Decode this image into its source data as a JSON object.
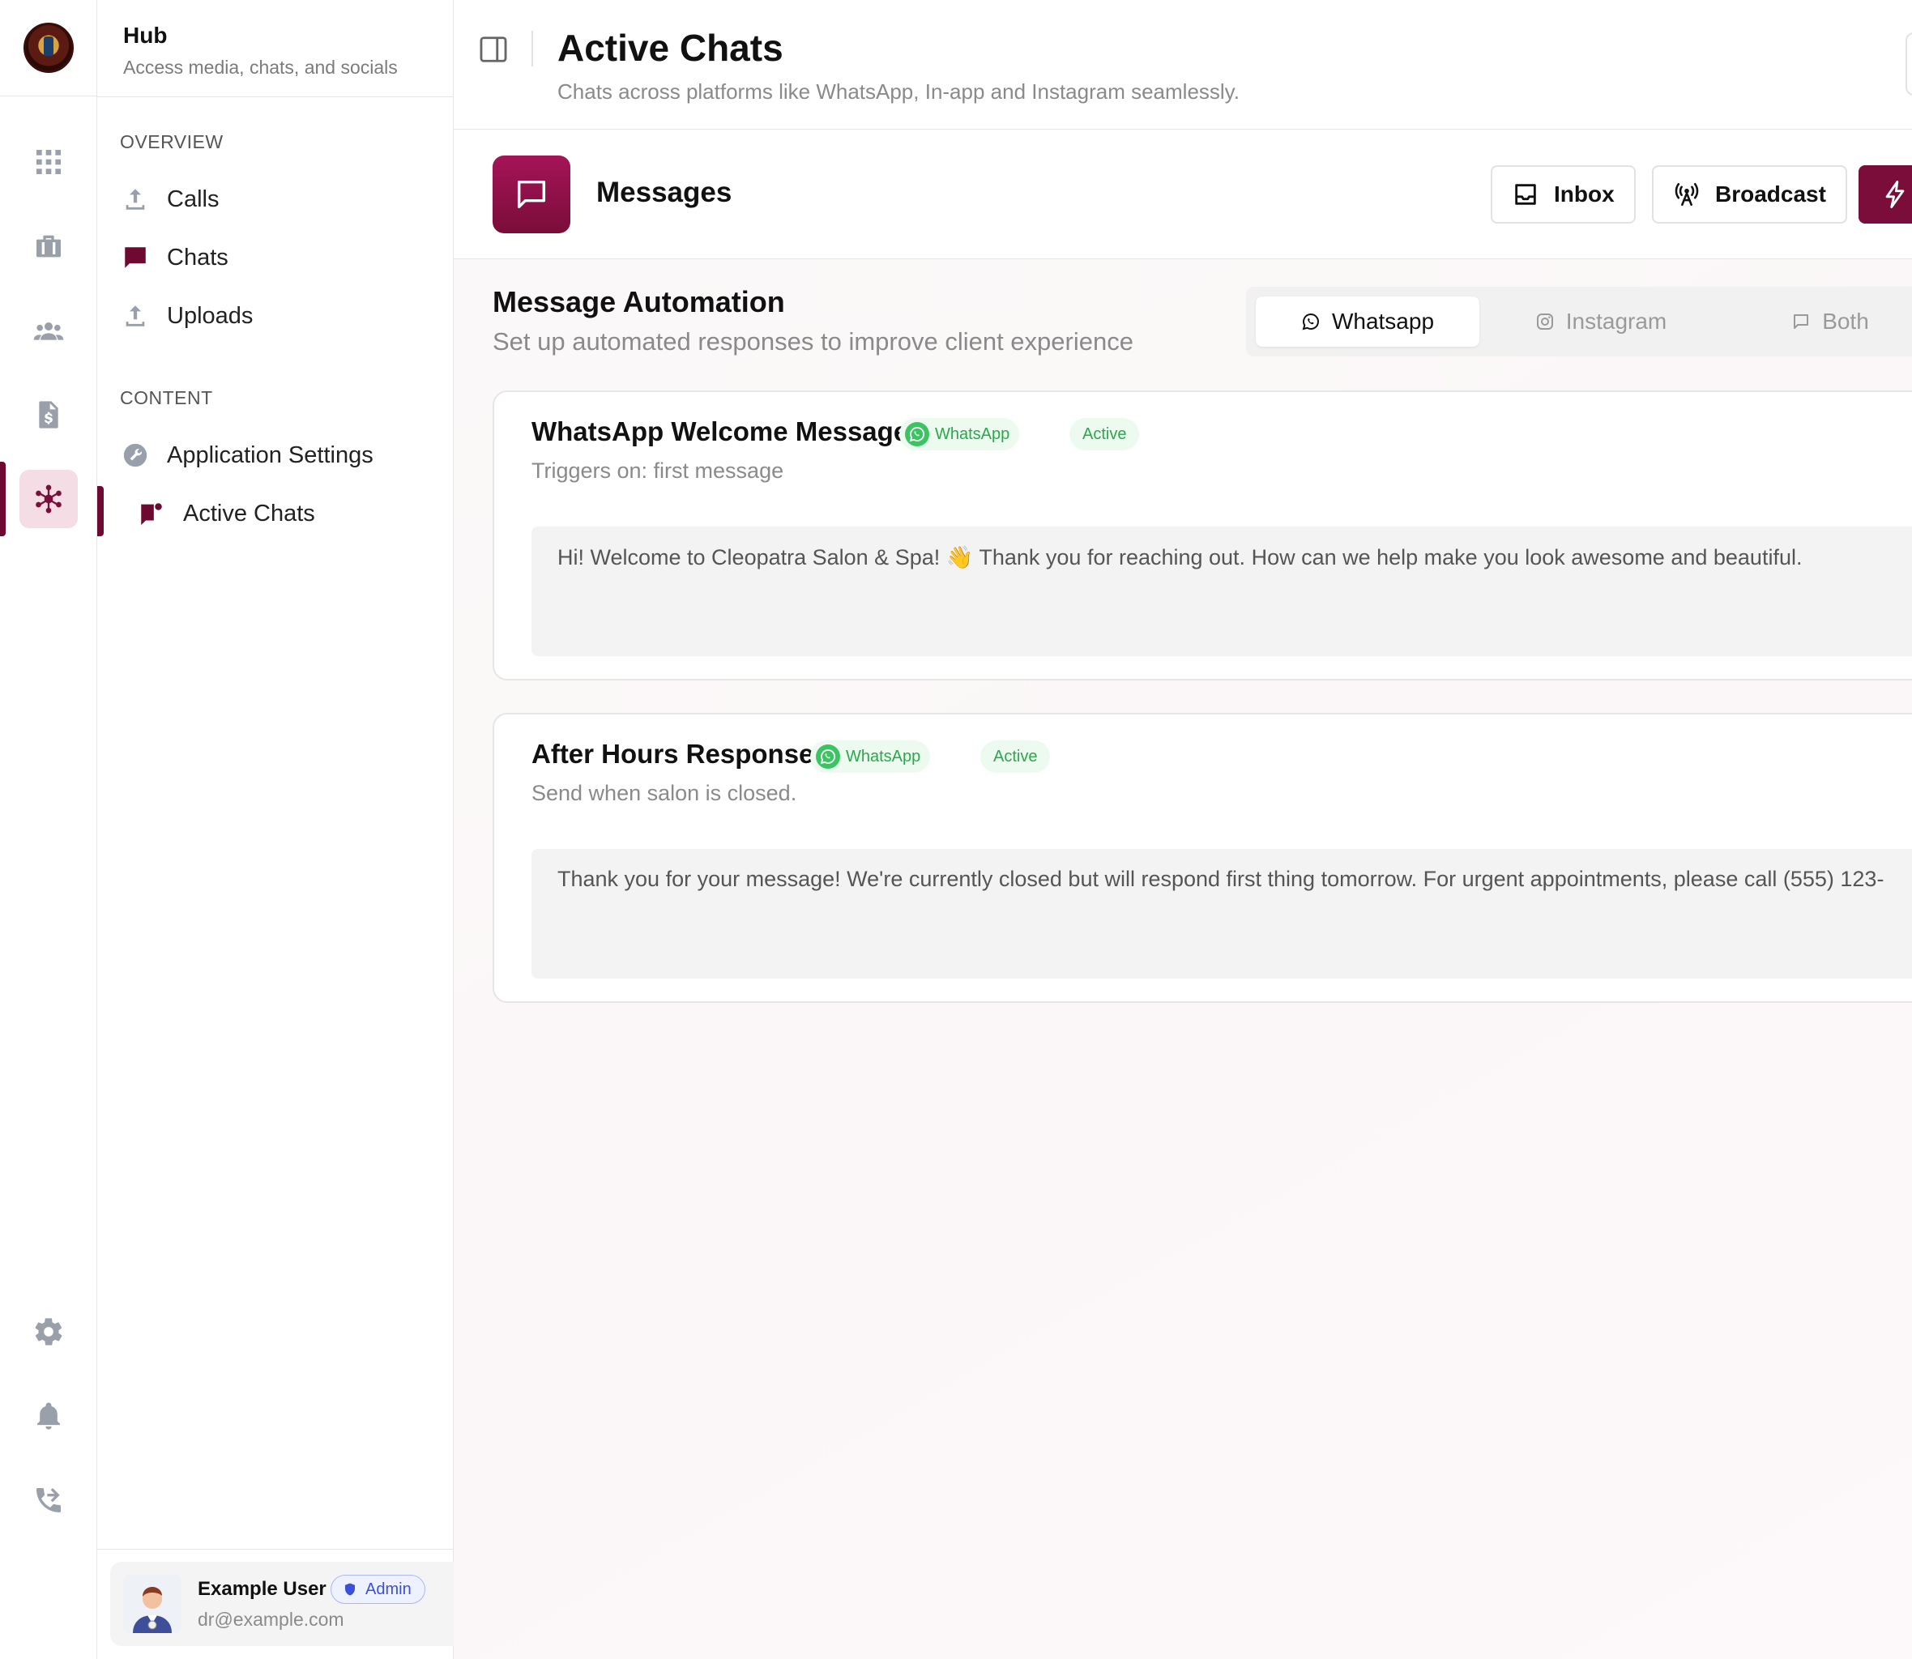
{
  "rail": {
    "icons": [
      "dashboard-icon",
      "briefcase-icon",
      "users-icon",
      "invoice-icon",
      "hub-icon",
      "settings-icon",
      "bell-icon",
      "phone-icon"
    ]
  },
  "sidebar": {
    "title": "Hub",
    "subtitle": "Access media, chats, and socials",
    "sections": [
      {
        "label": "OVERVIEW",
        "items": [
          {
            "label": "Calls"
          },
          {
            "label": "Chats"
          },
          {
            "label": "Uploads"
          }
        ]
      },
      {
        "label": "CONTENT",
        "items": [
          {
            "label": "Application Settings"
          },
          {
            "label": "Active Chats"
          }
        ]
      }
    ]
  },
  "user": {
    "name": "Example User",
    "role": "Admin",
    "email": "dr@example.com"
  },
  "header": {
    "title": "Active Chats",
    "subtitle": "Chats across platforms like WhatsApp, In-app and Instagram seamlessly."
  },
  "messages_bar": {
    "title": "Messages",
    "buttons": {
      "inbox": "Inbox",
      "broadcast": "Broadcast"
    }
  },
  "automation": {
    "title": "Message Automation",
    "subtitle": "Set up automated responses to improve client experience",
    "tabs": [
      {
        "label": "Whatsapp",
        "selected": true
      },
      {
        "label": "Instagram"
      },
      {
        "label": "Both"
      }
    ]
  },
  "cards": [
    {
      "title": "WhatsApp Welcome Message",
      "platform": "WhatsApp",
      "status": "Active",
      "trigger": "Triggers on: first message",
      "message": "Hi! Welcome to Cleopatra Salon & Spa! 👋 Thank you for reaching out. How can we help make you look awesome and beautiful."
    },
    {
      "title": "After Hours Response",
      "platform": "WhatsApp",
      "status": "Active",
      "trigger": "Send when salon is closed.",
      "message": "Thank you for your message! We're currently closed but will respond first thing tomorrow. For urgent appointments, please call (555) 123-"
    }
  ],
  "colors": {
    "brand": "#7a0d3a",
    "active_bg": "#f5dde6",
    "whatsapp": "#2aa84a",
    "admin": "#3b4fd8"
  }
}
